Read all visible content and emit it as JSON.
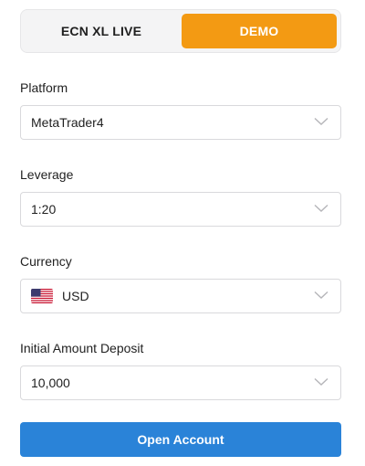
{
  "account_type": {
    "options": [
      "ECN XL LIVE",
      "DEMO"
    ],
    "selected": "DEMO"
  },
  "platform": {
    "label": "Platform",
    "value": "MetaTrader4"
  },
  "leverage": {
    "label": "Leverage",
    "value": "1:20"
  },
  "currency": {
    "label": "Currency",
    "value": "USD",
    "flag_icon": "us-flag-icon"
  },
  "deposit": {
    "label": "Initial Amount Deposit",
    "value": "10,000"
  },
  "submit": {
    "label": "Open Account"
  },
  "colors": {
    "accent_orange": "#f39a13",
    "primary_blue": "#2a83d8"
  }
}
